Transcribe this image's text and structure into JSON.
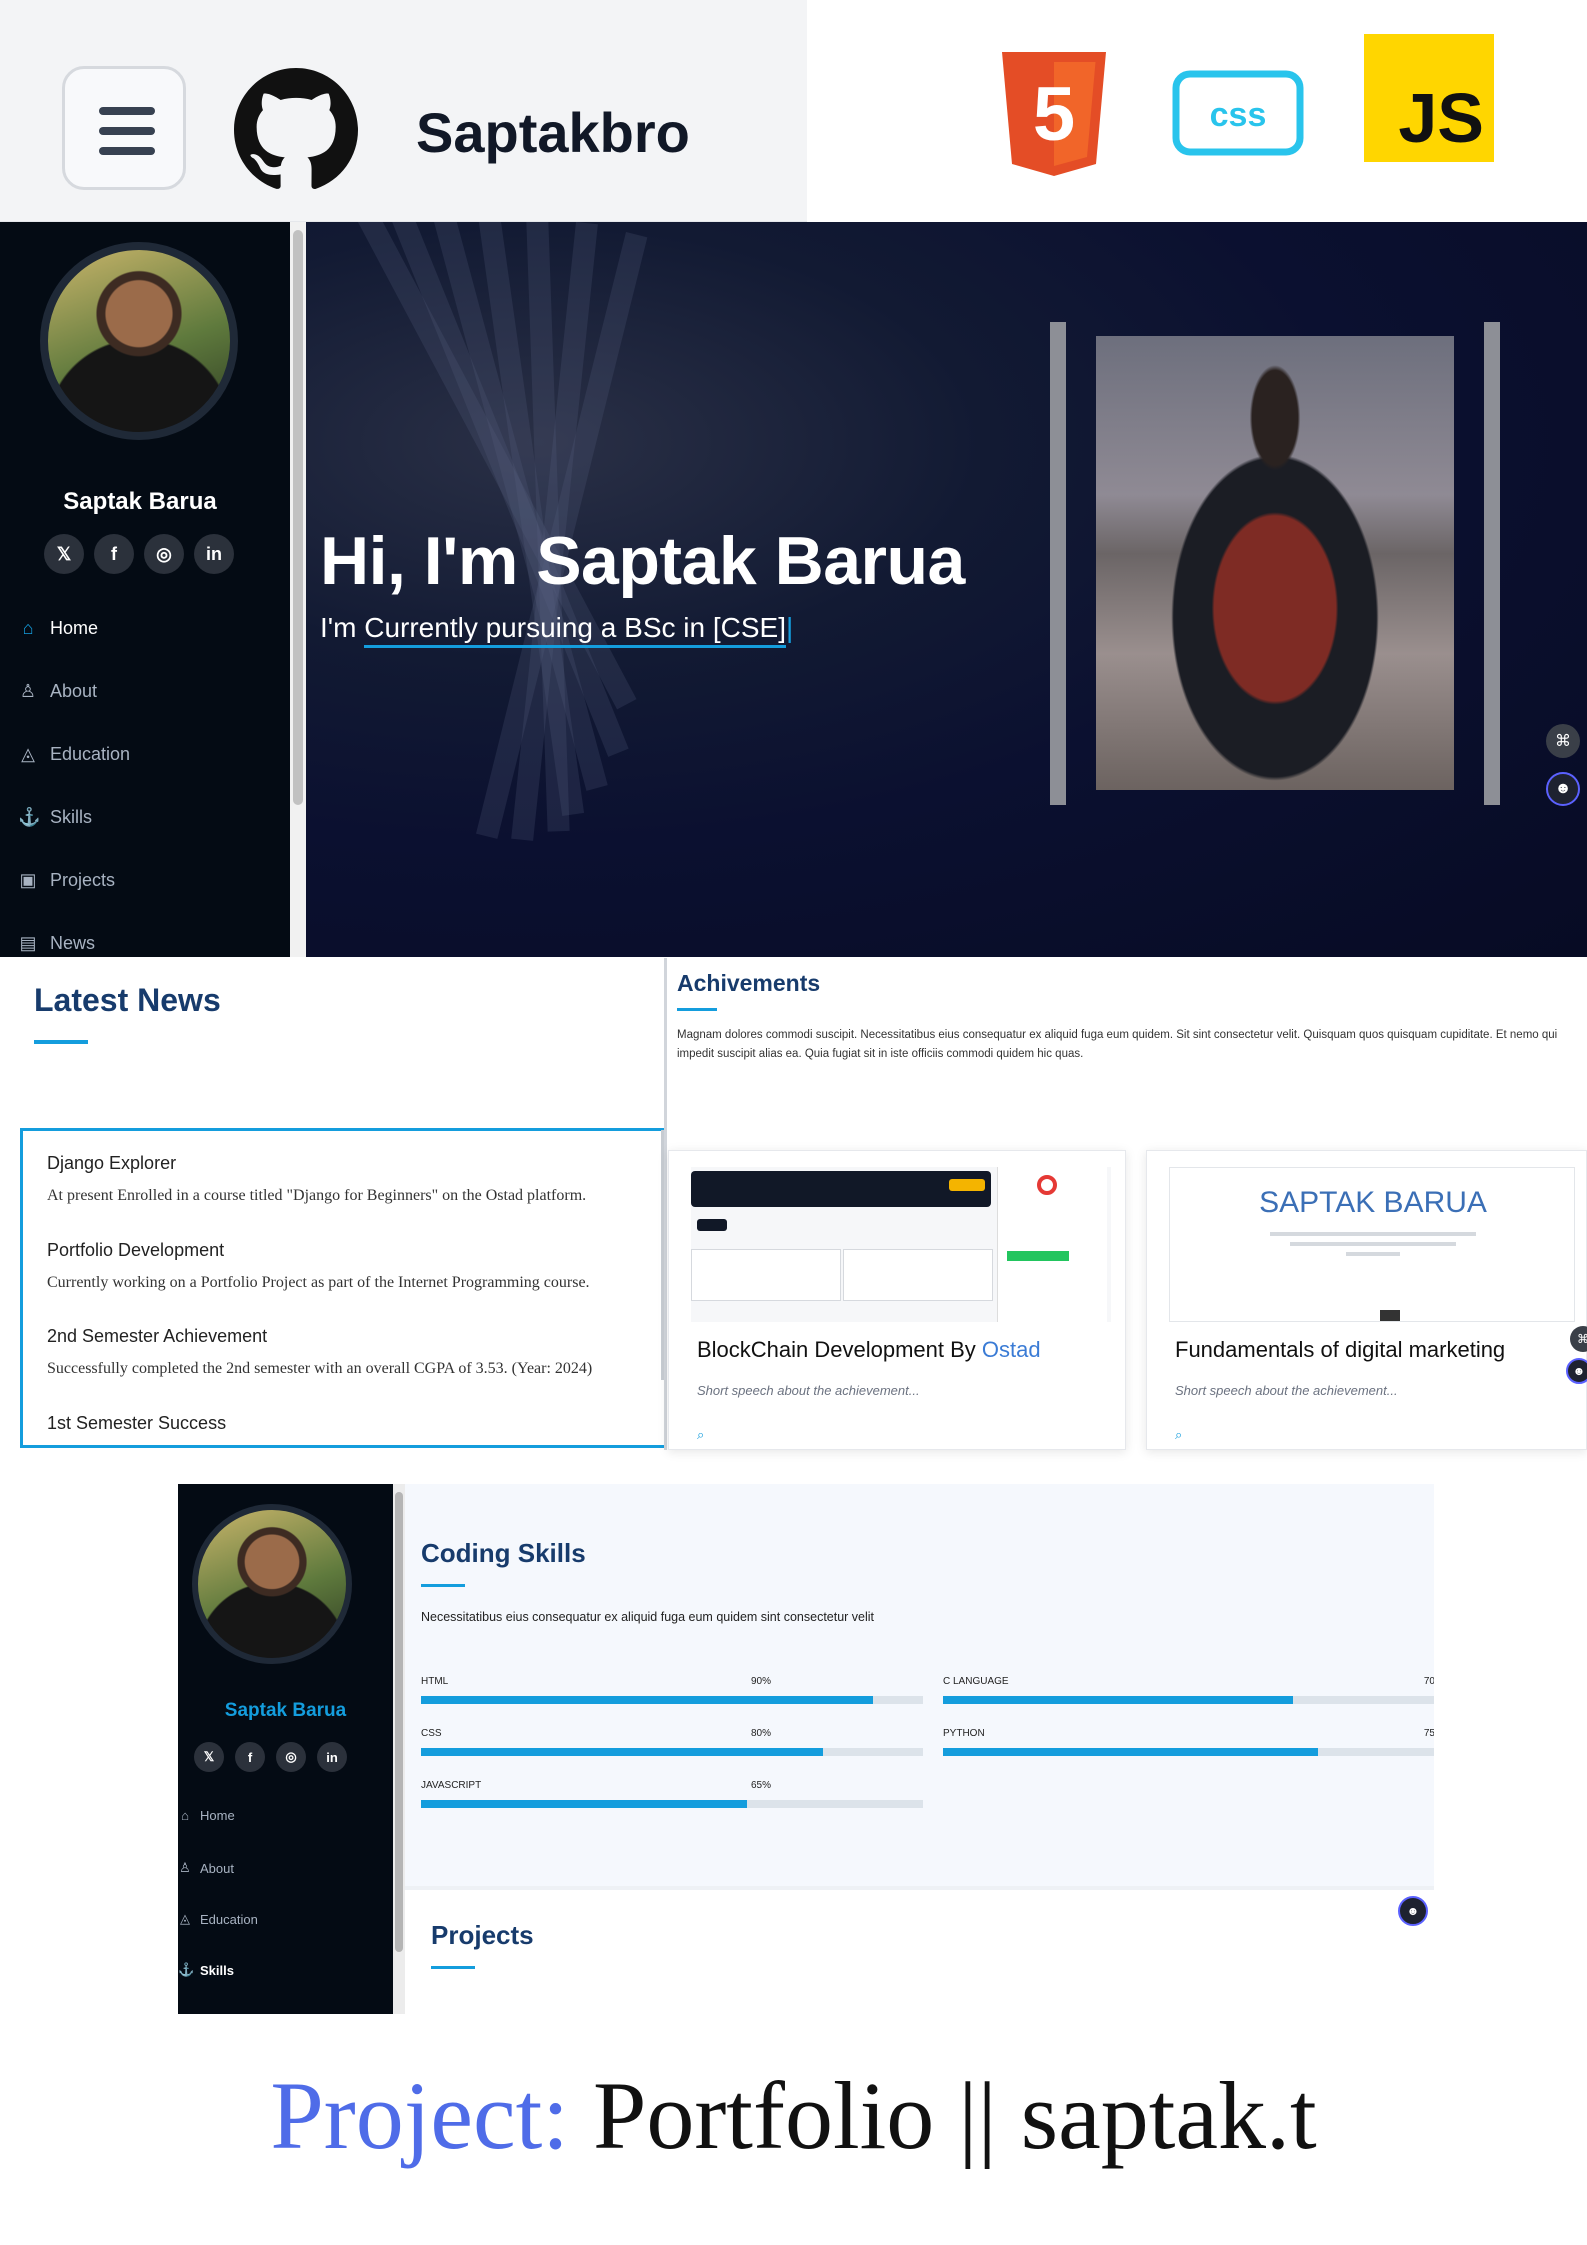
{
  "banner": {
    "brand_name": "Saptakbro",
    "tech_logos": [
      {
        "name": "html5-logo",
        "label": "5",
        "color": "#e44d26"
      },
      {
        "name": "css-logo",
        "label": "css",
        "color": "#29c4ec"
      },
      {
        "name": "js-logo",
        "label": "JS",
        "color": "#ffd600"
      }
    ]
  },
  "sidebar": {
    "name": "Saptak Barua",
    "socials": [
      "x-icon",
      "facebook-icon",
      "instagram-icon",
      "linkedin-icon"
    ],
    "nav": [
      {
        "label": "Home",
        "icon": "home-icon"
      },
      {
        "label": "About",
        "icon": "person-icon"
      },
      {
        "label": "Education",
        "icon": "graduation-icon"
      },
      {
        "label": "Skills",
        "icon": "anchor-icon"
      },
      {
        "label": "Projects",
        "icon": "box-icon"
      },
      {
        "label": "News",
        "icon": "document-icon"
      }
    ]
  },
  "hero": {
    "title": "Hi, I'm Saptak Barua",
    "subtitle_prefix": "I'm ",
    "subtitle_typed": "Currently pursuing a BSc in [CSE]",
    "caret": "|"
  },
  "news": {
    "title": "Latest News",
    "items": [
      {
        "title": "Django Explorer",
        "text": "At present Enrolled in a course titled \"Django for Beginners\" on the Ostad platform."
      },
      {
        "title": "Portfolio Development",
        "text": "Currently working on a Portfolio Project as part of the Internet Programming course."
      },
      {
        "title": "2nd Semester Achievement",
        "text": "Successfully completed the 2nd semester with an overall CGPA of 3.53. (Year: 2024)"
      },
      {
        "title": "1st Semester Success",
        "text": ""
      }
    ]
  },
  "achievements": {
    "title": "Achivements",
    "text": "Magnam dolores commodi suscipit. Necessitatibus eius consequatur ex aliquid fuga eum quidem. Sit sint consectetur velit. Quisquam quos quisquam cupiditate. Et nemo qui impedit suscipit alias ea. Quia fugiat sit in iste officiis commodi quidem hic quas.",
    "cards": [
      {
        "title": "BlockChain Development By ",
        "title_accent": "Ostad",
        "desc": "Short speech about the achievement...",
        "icon": "zoom-icon"
      },
      {
        "title": "Fundamentals of digital marketing",
        "title_accent": "",
        "desc": "Short speech about the achievement...",
        "icon": "zoom-icon",
        "cert_name": "SAPTAK BARUA"
      }
    ]
  },
  "skills": {
    "title": "Coding Skills",
    "intro": "Necessitatibus eius consequatur ex aliquid fuga eum quidem sint consectetur velit",
    "left": [
      {
        "label": "HTML",
        "percent": 90,
        "display": "90%"
      },
      {
        "label": "CSS",
        "percent": 80,
        "display": "80%"
      },
      {
        "label": "JAVASCRIPT",
        "percent": 65,
        "display": "65%"
      }
    ],
    "right": [
      {
        "label": "C LANGUAGE",
        "percent": 70,
        "display": "70"
      },
      {
        "label": "PYTHON",
        "percent": 75,
        "display": "75"
      }
    ],
    "sidebar_nav": [
      "Home",
      "About",
      "Education",
      "Skills"
    ]
  },
  "projects": {
    "title": "Projects"
  },
  "caption": {
    "keyword": "Project:",
    "text": " Portfolio || saptak.t"
  },
  "colors": {
    "accent": "#149ddd",
    "heading": "#173b6c",
    "sidebar_bg": "#040b14"
  }
}
